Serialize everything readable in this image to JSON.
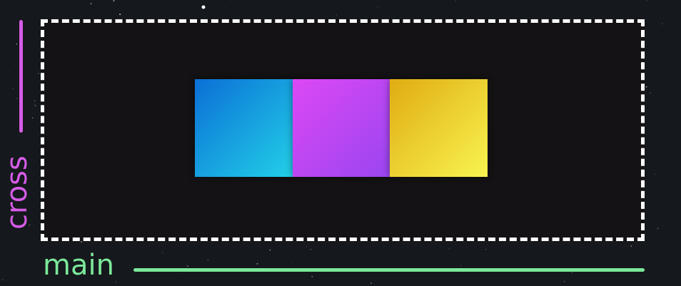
{
  "labels": {
    "cross": "cross",
    "main": "main"
  },
  "colors": {
    "background": "#15181c",
    "container_fill": "#141214",
    "container_border": "#ffffff",
    "cross_axis": "#d65ce8",
    "main_axis": "#7ce89a",
    "item_1": [
      "#0b6fd6",
      "#22d0e8"
    ],
    "item_2": [
      "#dc48f5",
      "#9a46f0"
    ],
    "item_3": [
      "#e0ac12",
      "#f8f450"
    ]
  }
}
